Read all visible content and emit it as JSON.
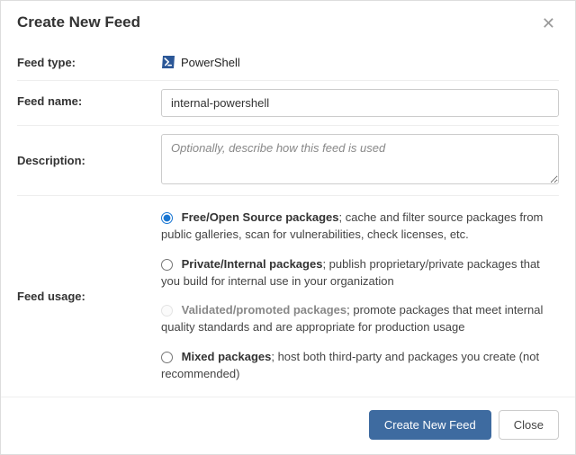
{
  "header": {
    "title": "Create New Feed",
    "close_glyph": "✕"
  },
  "labels": {
    "feed_type": "Feed type:",
    "feed_name": "Feed name:",
    "description": "Description:",
    "feed_usage": "Feed usage:"
  },
  "feed_type": {
    "icon_name": "powershell-icon",
    "text": "PowerShell"
  },
  "feed_name": {
    "value": "internal-powershell"
  },
  "description": {
    "placeholder": "Optionally, describe how this feed is used",
    "value": ""
  },
  "usage_options": [
    {
      "title": "Free/Open Source packages",
      "desc": "; cache and filter source packages from public galleries, scan for vulnerabilities, check licenses, etc.",
      "checked": true,
      "disabled": false
    },
    {
      "title": "Private/Internal packages",
      "desc": "; publish proprietary/private packages that you build for internal use in your organization",
      "checked": false,
      "disabled": false
    },
    {
      "title": "Validated/promoted packages",
      "desc": "; promote packages that meet internal quality standards and are appropriate for production usage",
      "checked": false,
      "disabled": true
    },
    {
      "title": "Mixed packages",
      "desc": "; host both third-party and packages you create (not recommended)",
      "checked": false,
      "disabled": false
    }
  ],
  "footer": {
    "primary": "Create New Feed",
    "secondary": "Close"
  }
}
